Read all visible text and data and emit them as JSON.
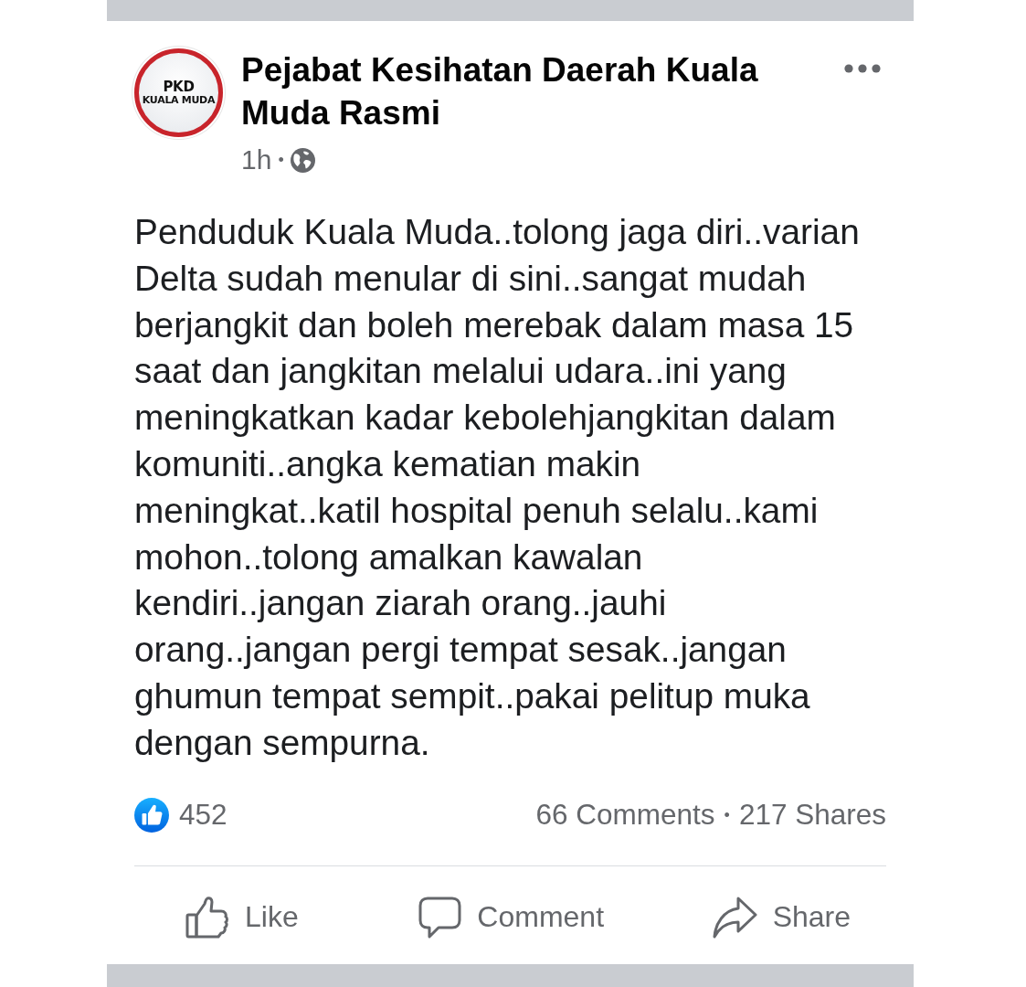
{
  "post": {
    "author": "Pejabat Kesihatan Daerah Kuala Muda Rasmi",
    "avatar": {
      "logo_lines": [
        "PKD",
        "KUALA MUDA"
      ]
    },
    "time": "1h",
    "time_separator": "•",
    "public": true,
    "body": "Penduduk Kuala Muda..tolong jaga diri..varian Delta sudah menular di sini..sangat mudah berjangkit dan boleh merebak dalam masa 15 saat dan jangkitan melalui udara..ini yang meningkatkan kadar kebolehjangkitan dalam komuniti..angka kematian makin meningkat..katil hospital penuh selalu..kami mohon..tolong amalkan kawalan kendiri..jangan ziarah orang..jauhi orang..jangan pergi tempat sesak..jangan ghumun tempat sempit..pakai pelitup muka dengan sempurna.",
    "reactions": {
      "kind": "like",
      "count": "452"
    },
    "comments": "66 Comments",
    "stats_separator": "•",
    "shares": "217 Shares"
  },
  "actions": [
    {
      "kind": "like",
      "label": "Like"
    },
    {
      "kind": "comment",
      "label": "Comment"
    },
    {
      "kind": "share",
      "label": "Share"
    }
  ]
}
